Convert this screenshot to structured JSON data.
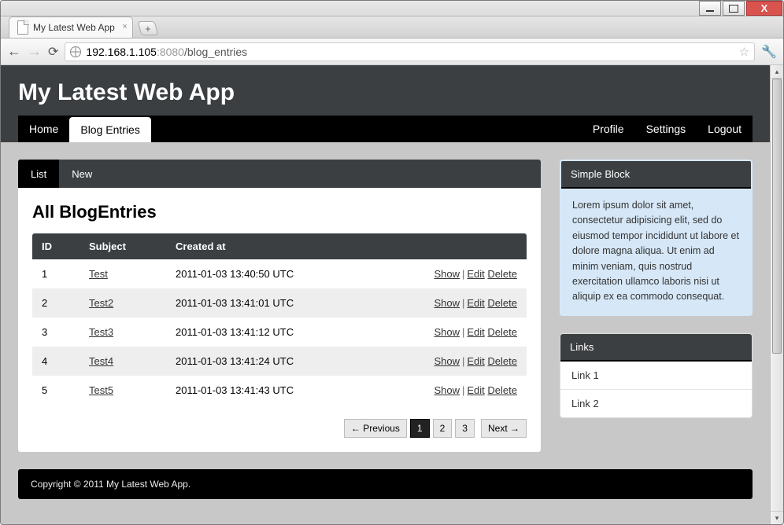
{
  "browser": {
    "tab_title": "My Latest Web App",
    "url_host": "192.168.1.105",
    "url_port": ":8080",
    "url_path": "/blog_entries"
  },
  "header": {
    "title": "My Latest Web App"
  },
  "primary_nav": {
    "left": [
      {
        "label": "Home",
        "active": false
      },
      {
        "label": "Blog Entries",
        "active": true
      }
    ],
    "right": [
      {
        "label": "Profile"
      },
      {
        "label": "Settings"
      },
      {
        "label": "Logout"
      }
    ]
  },
  "secondary_nav": {
    "items": [
      {
        "label": "List",
        "active": true
      },
      {
        "label": "New",
        "active": false
      }
    ]
  },
  "content": {
    "heading": "All BlogEntries",
    "columns": {
      "id": "ID",
      "subject": "Subject",
      "created_at": "Created at"
    },
    "actions": {
      "show": "Show",
      "edit": "Edit",
      "delete": "Delete"
    },
    "rows": [
      {
        "id": "1",
        "subject": "Test",
        "created_at": "2011-01-03 13:40:50 UTC"
      },
      {
        "id": "2",
        "subject": "Test2",
        "created_at": "2011-01-03 13:41:01 UTC"
      },
      {
        "id": "3",
        "subject": "Test3",
        "created_at": "2011-01-03 13:41:12 UTC"
      },
      {
        "id": "4",
        "subject": "Test4",
        "created_at": "2011-01-03 13:41:24 UTC"
      },
      {
        "id": "5",
        "subject": "Test5",
        "created_at": "2011-01-03 13:41:43 UTC"
      }
    ]
  },
  "pagination": {
    "prev": "← Previous",
    "pages": [
      "1",
      "2",
      "3"
    ],
    "active_index": 0,
    "next": "Next →"
  },
  "sidebar": {
    "simple_block": {
      "title": "Simple Block",
      "body": "Lorem ipsum dolor sit amet, consectetur adipisicing elit, sed do eiusmod tempor incididunt ut labore et dolore magna aliqua. Ut enim ad minim veniam, quis nostrud exercitation ullamco laboris nisi ut aliquip ex ea commodo consequat."
    },
    "links_block": {
      "title": "Links",
      "items": [
        {
          "label": "Link 1"
        },
        {
          "label": "Link 2"
        }
      ]
    }
  },
  "footer": {
    "text": "Copyright © 2011 My Latest Web App."
  }
}
